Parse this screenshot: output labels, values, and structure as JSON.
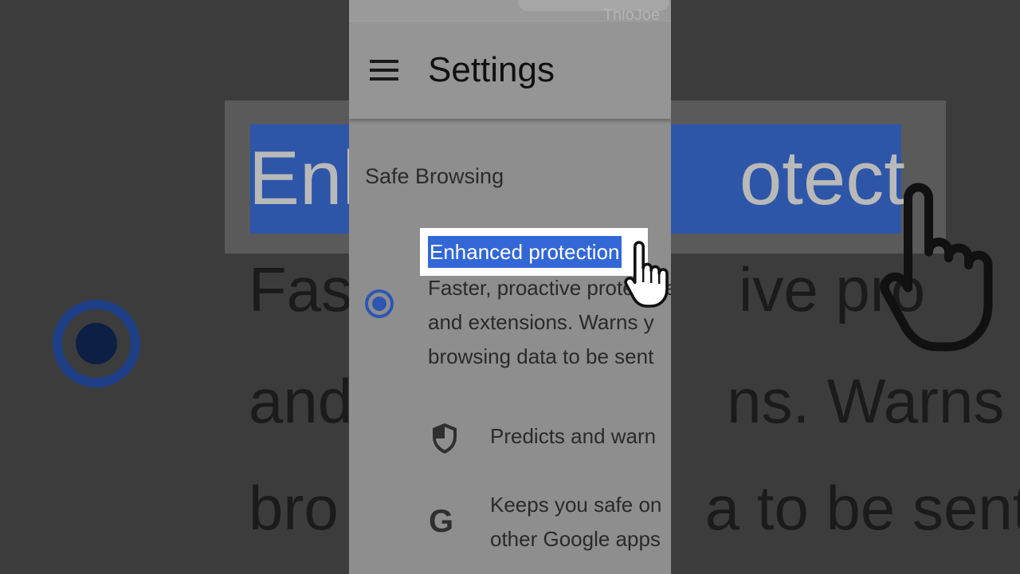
{
  "watermark": "ThioJoe",
  "appbar": {
    "title": "Settings",
    "menu_icon": "hamburger-menu-icon"
  },
  "section": {
    "title": "Safe Browsing"
  },
  "option": {
    "title": "Enhanced protection",
    "selected": true,
    "description_lines": [
      "Faster, proactive protective",
      "and extensions. Warns y",
      "browsing data to be sent"
    ]
  },
  "features": [
    {
      "icon": "shield-icon",
      "text": [
        "Predicts and warn"
      ]
    },
    {
      "icon": "google-g-icon",
      "glyph": "G",
      "text": [
        "Keeps you safe on",
        "other Google apps"
      ]
    }
  ],
  "background": {
    "title_fragments": [
      "Enh",
      "otection"
    ],
    "desc_lines": [
      "Fas",
      "ive pro",
      "and",
      "ns. Warns y",
      "bro",
      "a to be sent"
    ]
  },
  "colors": {
    "accent": "#3367d6",
    "radio": "#2d56b4",
    "panel": "#8e8e8e",
    "backdrop": "#3c3c3c"
  }
}
